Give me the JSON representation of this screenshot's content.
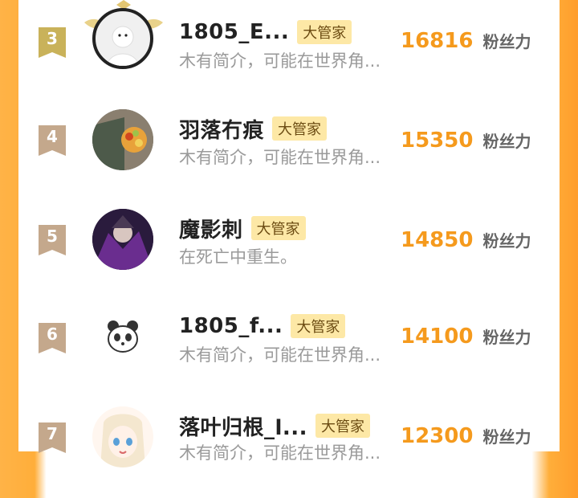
{
  "rows": [
    {
      "rank": "3",
      "name": "1805_E...",
      "badge": "大管家",
      "bio": "木有简介，可能在世界角...",
      "score": "16816",
      "unit": "粉丝力",
      "ribbon_color": "#c9b25a"
    },
    {
      "rank": "4",
      "name": "羽落冇痕",
      "badge": "大管家",
      "bio": "木有简介，可能在世界角...",
      "score": "15350",
      "unit": "粉丝力",
      "ribbon_color": "#c4a88c"
    },
    {
      "rank": "5",
      "name": "魔影刺",
      "badge": "大管家",
      "bio": "在死亡中重生。",
      "score": "14850",
      "unit": "粉丝力",
      "ribbon_color": "#c4a88c"
    },
    {
      "rank": "6",
      "name": "1805_f...",
      "badge": "大管家",
      "bio": "木有简介，可能在世界角...",
      "score": "14100",
      "unit": "粉丝力",
      "ribbon_color": "#c4a88c"
    },
    {
      "rank": "7",
      "name": "落叶归根_l...",
      "badge": "大管家",
      "bio": "木有简介，可能在世界角...",
      "score": "12300",
      "unit": "粉丝力",
      "ribbon_color": "#c4a88c"
    }
  ]
}
